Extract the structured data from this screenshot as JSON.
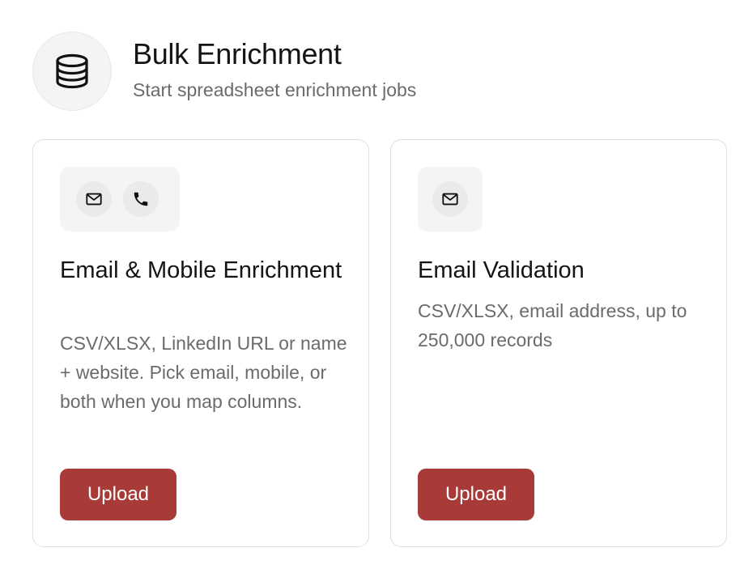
{
  "header": {
    "icon": "database-icon",
    "title": "Bulk Enrichment",
    "subtitle": "Start spreadsheet enrichment jobs"
  },
  "cards": [
    {
      "icons": [
        "mail-icon",
        "phone-icon"
      ],
      "title": "Email & Mobile Enrichment",
      "description": "CSV/XLSX, LinkedIn URL or name + website. Pick email, mobile, or both when you map columns.",
      "button_label": "Upload"
    },
    {
      "icons": [
        "mail-icon"
      ],
      "title": "Email Validation",
      "description": "CSV/XLSX, email address, up to 250,000 records",
      "button_label": "Upload"
    }
  ],
  "colors": {
    "accent": "#a83a38",
    "icon_bg": "#f3f4f5",
    "border": "#dedfe1",
    "muted_text": "#6b6b6b"
  }
}
